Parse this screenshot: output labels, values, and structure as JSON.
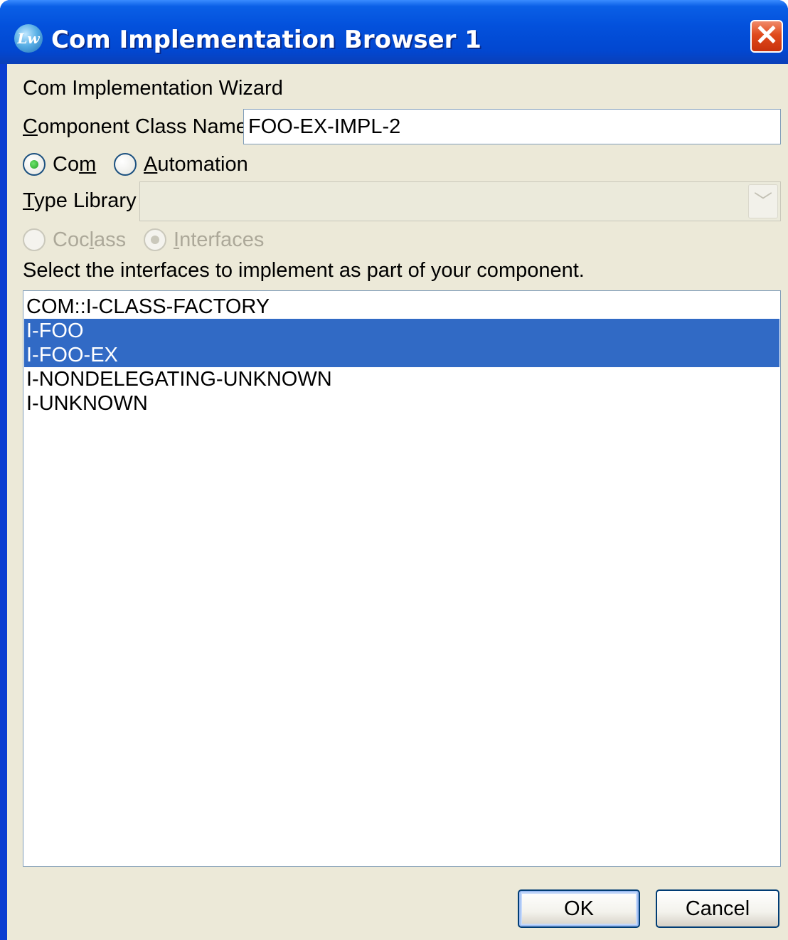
{
  "window": {
    "title": "Com Implementation Browser 1",
    "app_icon": "lw-icon",
    "close_icon": "close-icon"
  },
  "wizard_heading": "Com Implementation Wizard",
  "component_class": {
    "label_mnemonic": "C",
    "label_rest": "omponent Class Name",
    "value": "FOO-EX-IMPL-2"
  },
  "kind_options": {
    "com": {
      "pre": "Co",
      "mnemonic": "m",
      "post": "",
      "selected": true
    },
    "automation": {
      "pre": "",
      "mnemonic": "A",
      "post": "utomation",
      "selected": false
    }
  },
  "type_library": {
    "label_mnemonic": "T",
    "label_rest": "ype Library",
    "value": "",
    "disabled": true
  },
  "scope_options": {
    "coclass": {
      "pre": "Coc",
      "mnemonic": "l",
      "post": "ass",
      "selected": false,
      "disabled": true
    },
    "interfaces": {
      "pre": "",
      "mnemonic": "I",
      "post": "nterfaces",
      "selected": true,
      "disabled": true
    }
  },
  "instruction": "Select the interfaces to implement as part of your component.",
  "interfaces": [
    {
      "label": "COM::I-CLASS-FACTORY",
      "selected": false
    },
    {
      "label": "I-FOO",
      "selected": true
    },
    {
      "label": "I-FOO-EX",
      "selected": true
    },
    {
      "label": "I-NONDELEGATING-UNKNOWN",
      "selected": false
    },
    {
      "label": "I-UNKNOWN",
      "selected": false
    }
  ],
  "buttons": {
    "ok": "OK",
    "cancel": "Cancel"
  },
  "colors": {
    "selection": "#316ac5",
    "titlebar": "#0247d0",
    "dialog_bg": "#ece9d8"
  }
}
